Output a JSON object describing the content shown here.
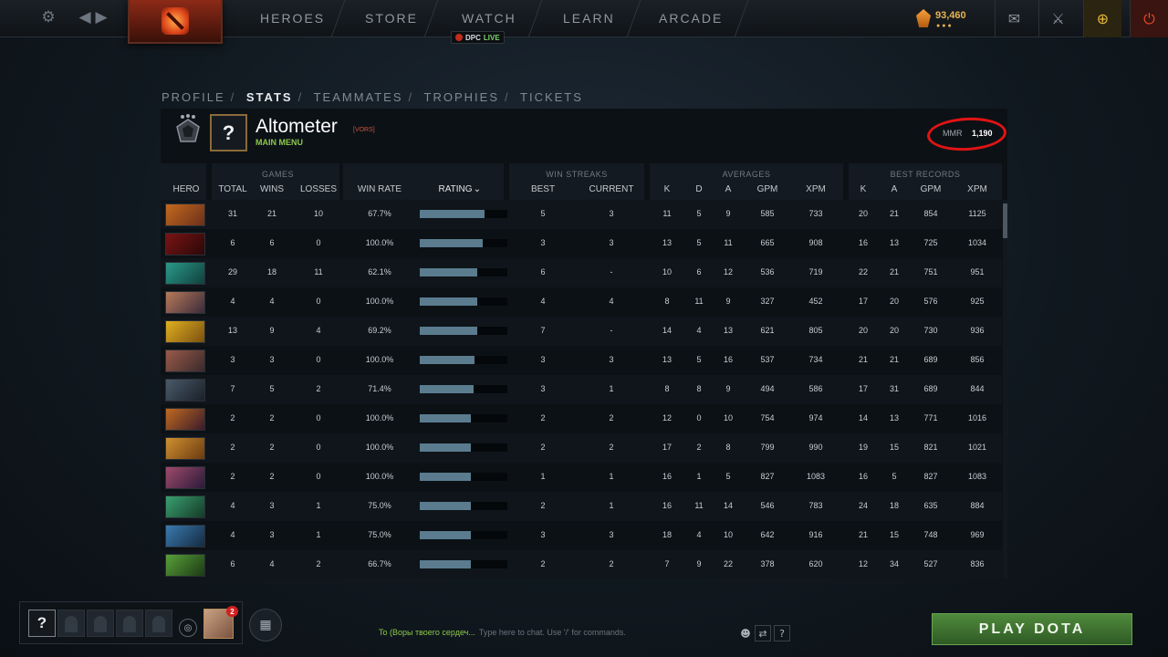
{
  "topbar": {
    "nav": [
      {
        "label": "HEROES",
        "name": "nav-heroes"
      },
      {
        "label": "STORE",
        "name": "nav-store"
      },
      {
        "label": "WATCH",
        "name": "nav-watch"
      },
      {
        "label": "LEARN",
        "name": "nav-learn"
      },
      {
        "label": "ARCADE",
        "name": "nav-arcade"
      }
    ],
    "dpc_label": "DPC",
    "dpc_live": "LIVE",
    "shards": "93,460",
    "shards_dots": "●●●",
    "icons": {
      "settings": "gear-icon",
      "back": "back-arrow-icon",
      "forward": "forward-arrow-icon",
      "logo": "dota-logo-icon",
      "shards": "shards-icon",
      "mail": "mail-icon",
      "armory": "armory-icon",
      "plus": "dota-plus-icon",
      "power": "power-icon"
    }
  },
  "breadcrumb": {
    "items": [
      "PROFILE",
      "STATS",
      "TEAMMATES",
      "TROPHIES",
      "TICKETS"
    ],
    "active": "STATS",
    "separator": "/"
  },
  "profile": {
    "name": "Altometer",
    "tag": "[VORS]",
    "status": "MAIN MENU",
    "avatar_placeholder": "?",
    "mmr_label": "MMR",
    "mmr_value": "1,190"
  },
  "stats_table": {
    "groups": {
      "games": "GAMES",
      "win_streaks": "WIN STREAKS",
      "averages": "AVERAGES",
      "best_records": "BEST RECORDS"
    },
    "columns": {
      "hero": "HERO",
      "total": "TOTAL",
      "wins": "WINS",
      "losses": "LOSSES",
      "win_rate": "WIN RATE",
      "rating": "RATING",
      "rating_sort_icon": "chevron-down-icon",
      "best": "BEST",
      "current": "CURRENT",
      "avg_k": "K",
      "avg_d": "D",
      "avg_a": "A",
      "avg_gpm": "GPM",
      "avg_xpm": "XPM",
      "rec_k": "K",
      "rec_a": "A",
      "rec_gpm": "GPM",
      "rec_xpm": "XPM"
    },
    "rows": [
      {
        "total": "31",
        "wins": "21",
        "losses": "10",
        "win_rate": "67.7%",
        "rating": 0.74,
        "best": "5",
        "current": "3",
        "k": "11",
        "d": "5",
        "a": "9",
        "gpm": "585",
        "xpm": "733",
        "rk": "20",
        "ra": "21",
        "rgpm": "854",
        "rxpm": "1125",
        "colors": [
          "#c4691e",
          "#6b2f1a"
        ]
      },
      {
        "total": "6",
        "wins": "6",
        "losses": "0",
        "win_rate": "100.0%",
        "rating": 0.72,
        "best": "3",
        "current": "3",
        "k": "13",
        "d": "5",
        "a": "11",
        "gpm": "665",
        "xpm": "908",
        "rk": "16",
        "ra": "13",
        "rgpm": "725",
        "rxpm": "1034",
        "colors": [
          "#7a1414",
          "#2a0808"
        ]
      },
      {
        "total": "29",
        "wins": "18",
        "losses": "11",
        "win_rate": "62.1%",
        "rating": 0.66,
        "best": "6",
        "current": "-",
        "k": "10",
        "d": "6",
        "a": "12",
        "gpm": "536",
        "xpm": "719",
        "rk": "22",
        "ra": "21",
        "rgpm": "751",
        "rxpm": "951",
        "colors": [
          "#2a9a8a",
          "#10403c"
        ]
      },
      {
        "total": "4",
        "wins": "4",
        "losses": "0",
        "win_rate": "100.0%",
        "rating": 0.66,
        "best": "4",
        "current": "4",
        "k": "8",
        "d": "11",
        "a": "9",
        "gpm": "327",
        "xpm": "452",
        "rk": "17",
        "ra": "20",
        "rgpm": "576",
        "rxpm": "925",
        "colors": [
          "#b87a5a",
          "#3a2a3a"
        ]
      },
      {
        "total": "13",
        "wins": "9",
        "losses": "4",
        "win_rate": "69.2%",
        "rating": 0.66,
        "best": "7",
        "current": "-",
        "k": "14",
        "d": "4",
        "a": "13",
        "gpm": "621",
        "xpm": "805",
        "rk": "20",
        "ra": "20",
        "rgpm": "730",
        "rxpm": "936",
        "colors": [
          "#e0b020",
          "#7a5010"
        ]
      },
      {
        "total": "3",
        "wins": "3",
        "losses": "0",
        "win_rate": "100.0%",
        "rating": 0.62,
        "best": "3",
        "current": "3",
        "k": "13",
        "d": "5",
        "a": "16",
        "gpm": "537",
        "xpm": "734",
        "rk": "21",
        "ra": "21",
        "rgpm": "689",
        "rxpm": "856",
        "colors": [
          "#9a5a4a",
          "#3a2a2a"
        ]
      },
      {
        "total": "7",
        "wins": "5",
        "losses": "2",
        "win_rate": "71.4%",
        "rating": 0.61,
        "best": "3",
        "current": "1",
        "k": "8",
        "d": "8",
        "a": "9",
        "gpm": "494",
        "xpm": "586",
        "rk": "17",
        "ra": "31",
        "rgpm": "689",
        "rxpm": "844",
        "colors": [
          "#4a5a6a",
          "#1a2028"
        ]
      },
      {
        "total": "2",
        "wins": "2",
        "losses": "0",
        "win_rate": "100.0%",
        "rating": 0.58,
        "best": "2",
        "current": "2",
        "k": "12",
        "d": "0",
        "a": "10",
        "gpm": "754",
        "xpm": "974",
        "rk": "14",
        "ra": "13",
        "rgpm": "771",
        "rxpm": "1016",
        "colors": [
          "#c06a20",
          "#3a1a2a"
        ]
      },
      {
        "total": "2",
        "wins": "2",
        "losses": "0",
        "win_rate": "100.0%",
        "rating": 0.58,
        "best": "2",
        "current": "2",
        "k": "17",
        "d": "2",
        "a": "8",
        "gpm": "799",
        "xpm": "990",
        "rk": "19",
        "ra": "15",
        "rgpm": "821",
        "rxpm": "1021",
        "colors": [
          "#d09030",
          "#6a3a10"
        ]
      },
      {
        "total": "2",
        "wins": "2",
        "losses": "0",
        "win_rate": "100.0%",
        "rating": 0.58,
        "best": "1",
        "current": "1",
        "k": "16",
        "d": "1",
        "a": "5",
        "gpm": "827",
        "xpm": "1083",
        "rk": "16",
        "ra": "5",
        "rgpm": "827",
        "rxpm": "1083",
        "colors": [
          "#a04a6a",
          "#2a1a3a"
        ]
      },
      {
        "total": "4",
        "wins": "3",
        "losses": "1",
        "win_rate": "75.0%",
        "rating": 0.58,
        "best": "2",
        "current": "1",
        "k": "16",
        "d": "11",
        "a": "14",
        "gpm": "546",
        "xpm": "783",
        "rk": "24",
        "ra": "18",
        "rgpm": "635",
        "rxpm": "884",
        "colors": [
          "#3aa070",
          "#143a28"
        ]
      },
      {
        "total": "4",
        "wins": "3",
        "losses": "1",
        "win_rate": "75.0%",
        "rating": 0.58,
        "best": "3",
        "current": "3",
        "k": "18",
        "d": "4",
        "a": "10",
        "gpm": "642",
        "xpm": "916",
        "rk": "21",
        "ra": "15",
        "rgpm": "748",
        "rxpm": "969",
        "colors": [
          "#3a7ab0",
          "#142a40"
        ]
      },
      {
        "total": "6",
        "wins": "4",
        "losses": "2",
        "win_rate": "66.7%",
        "rating": 0.58,
        "best": "2",
        "current": "2",
        "k": "7",
        "d": "9",
        "a": "22",
        "gpm": "378",
        "xpm": "620",
        "rk": "12",
        "ra": "34",
        "rgpm": "527",
        "rxpm": "836",
        "colors": [
          "#5aa03a",
          "#1a3a14"
        ]
      }
    ]
  },
  "bottom": {
    "me_placeholder": "?",
    "friend_badge": "2",
    "chat_channel": "To (Воры твоего сердеч...",
    "chat_placeholder": "Type here to chat. Use '/' for commands.",
    "help_label": "?",
    "play_label": "PLAY DOTA"
  }
}
